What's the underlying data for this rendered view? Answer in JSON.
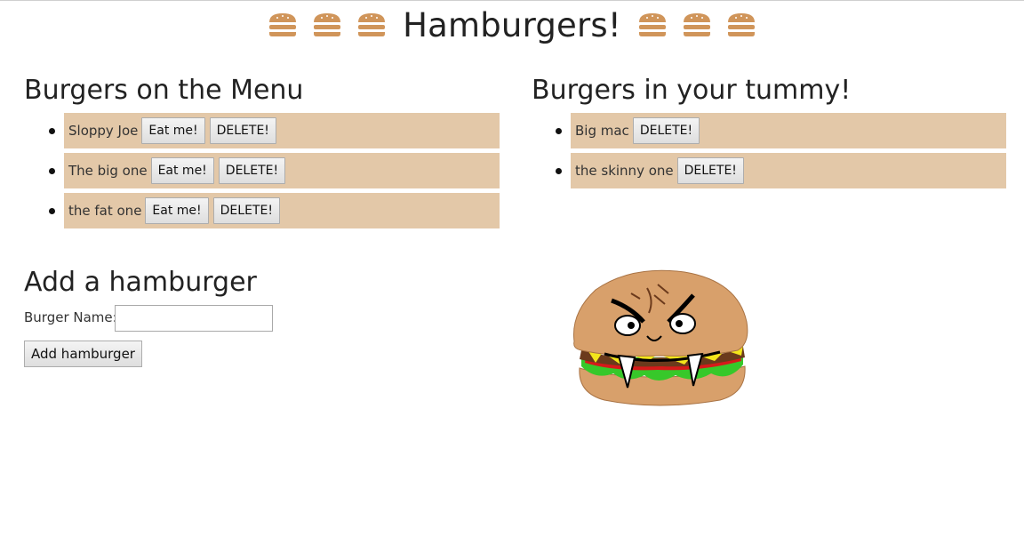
{
  "header": {
    "title": "Hamburgers!",
    "icon": "hamburger-icon",
    "icon_color": "#d0955a"
  },
  "menu": {
    "heading": "Burgers on the Menu",
    "items": [
      {
        "name": "Sloppy Joe",
        "eat_label": "Eat me!",
        "delete_label": "DELETE!"
      },
      {
        "name": "The big one",
        "eat_label": "Eat me!",
        "delete_label": "DELETE!"
      },
      {
        "name": "the fat one",
        "eat_label": "Eat me!",
        "delete_label": "DELETE!"
      }
    ]
  },
  "tummy": {
    "heading": "Burgers in your tummy!",
    "items": [
      {
        "name": "Big mac",
        "delete_label": "DELETE!"
      },
      {
        "name": "the skinny one",
        "delete_label": "DELETE!"
      }
    ]
  },
  "add_form": {
    "heading": "Add a hamburger",
    "name_label": "Burger Name:",
    "name_value": "",
    "submit_label": "Add hamburger"
  },
  "colors": {
    "item_background": "#e3c8a8",
    "burger_icon": "#d0955a"
  },
  "illustration": {
    "name": "angry-burger-monster"
  }
}
